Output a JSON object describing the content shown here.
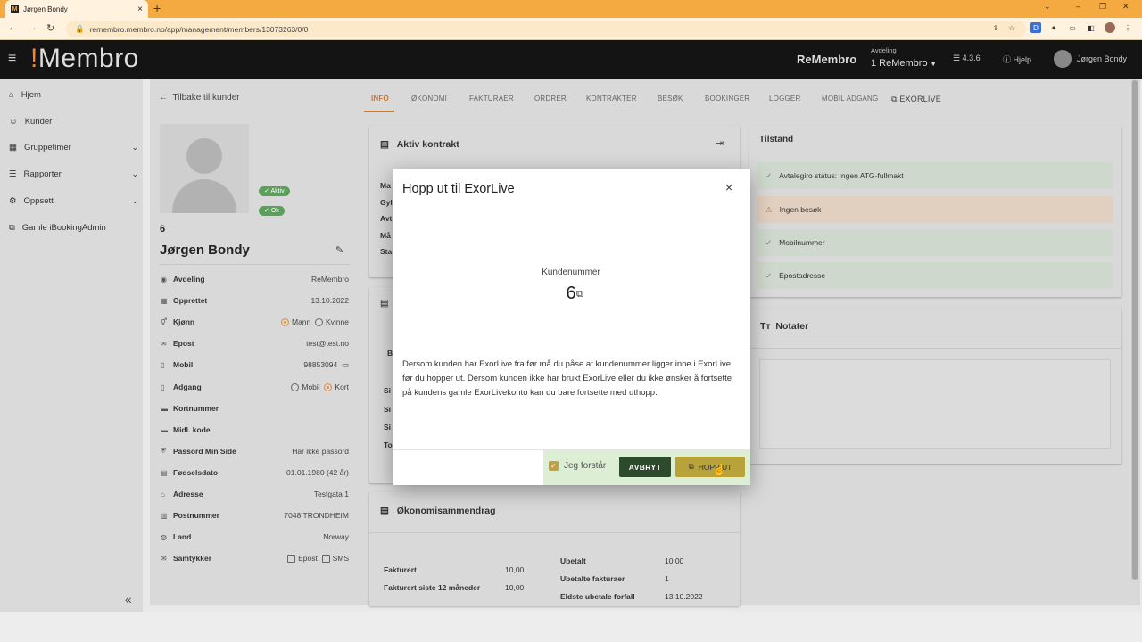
{
  "browser": {
    "tab_title": "Jørgen Bondy",
    "url": "remembro.membro.no/app/management/members/13073263/0/0"
  },
  "header": {
    "logo_mark": "!",
    "logo_text": "Membro",
    "org": "ReMembro",
    "dept_label": "Avdeling",
    "dept_value": "1 ReMembro",
    "version": "4.3.6",
    "help": "Hjelp",
    "user": "Jørgen Bondy"
  },
  "sidebar": {
    "items": [
      {
        "label": "Hjem",
        "icon": "home-icon"
      },
      {
        "label": "Kunder",
        "icon": "users-icon"
      },
      {
        "label": "Gruppetimer",
        "icon": "calendar-icon"
      },
      {
        "label": "Rapporter",
        "icon": "list-icon"
      },
      {
        "label": "Oppsett",
        "icon": "gear-icon"
      },
      {
        "label": "Gamle iBookingAdmin",
        "icon": "external-link-icon"
      }
    ]
  },
  "back_label": "Tilbake til kunder",
  "tabs": [
    "INFO",
    "ØKONOMI",
    "FAKTURAER",
    "ORDRER",
    "KONTRAKTER",
    "BESØK",
    "BOOKINGER",
    "LOGGER",
    "MOBIL ADGANG",
    "EXORLIVE"
  ],
  "customer": {
    "badge_active": "Aktiv",
    "badge_ok": "Ok",
    "number": "6",
    "name": "Jørgen Bondy",
    "rows": [
      {
        "label": "Avdeling",
        "value": "ReMembro"
      },
      {
        "label": "Opprettet",
        "value": "13.10.2022"
      },
      {
        "label": "Kjønn",
        "opt1": "Mann",
        "opt2": "Kvinne"
      },
      {
        "label": "Epost",
        "value": "test@test.no"
      },
      {
        "label": "Mobil",
        "value": "98853094"
      },
      {
        "label": "Adgang",
        "opt1": "Mobil",
        "opt2": "Kort"
      },
      {
        "label": "Kortnummer",
        "value": ""
      },
      {
        "label": "Midl. kode",
        "value": ""
      },
      {
        "label": "Passord Min Side",
        "value": "Har ikke passord"
      },
      {
        "label": "Fødselsdato",
        "value": "01.01.1980 (42 år)"
      },
      {
        "label": "Adresse",
        "value": "Testgata 1"
      },
      {
        "label": "Postnummer",
        "value": "7048 TRONDHEIM"
      },
      {
        "label": "Land",
        "value": "Norway"
      },
      {
        "label": "Samtykker",
        "opt1": "Epost",
        "opt2": "SMS"
      }
    ]
  },
  "contract_card": {
    "title": "Aktiv kontrakt",
    "partial_labels": [
      "Ma",
      "Gyl",
      "Avt",
      "Må",
      "Sta"
    ]
  },
  "second_card_partial": [
    "B",
    "Si",
    "Si",
    "Si",
    "To"
  ],
  "tilstand": {
    "title": "Tilstand",
    "rows": [
      {
        "text": "Avtalegiro status: Ingen ATG-fullmakt",
        "kind": "ok"
      },
      {
        "text": "Ingen besøk",
        "kind": "warn"
      },
      {
        "text": "Mobilnummer",
        "kind": "ok"
      },
      {
        "text": "Epostadresse",
        "kind": "ok"
      }
    ]
  },
  "notes": {
    "title": "Notater"
  },
  "economy": {
    "title": "Økonomisammendrag",
    "left": [
      {
        "label": "Fakturert",
        "value": "10,00"
      },
      {
        "label": "Fakturert siste 12 måneder",
        "value": "10,00"
      }
    ],
    "right": [
      {
        "label": "Ubetalt",
        "value": "10,00"
      },
      {
        "label": "Ubetalte fakturaer",
        "value": "1"
      },
      {
        "label": "Eldste ubetale forfall",
        "value": "13.10.2022"
      }
    ]
  },
  "modal": {
    "title": "Hopp ut til ExorLive",
    "close": "×",
    "customer_number_label": "Kundenummer",
    "customer_number": "6",
    "text": "Dersom kunden har ExorLive fra før må du påse at kundenummer ligger inne i ExorLive før du hopper ut. Dersom kunden ikke har brukt ExorLive eller du ikke ønsker å fortsette på kundens gamle ExorLivekonto kan du bare fortsette med uthopp.",
    "understand_label": "Jeg forstår",
    "understand_checked": true,
    "cancel_label": "AVBRYT",
    "go_label": "HOPP UT"
  }
}
